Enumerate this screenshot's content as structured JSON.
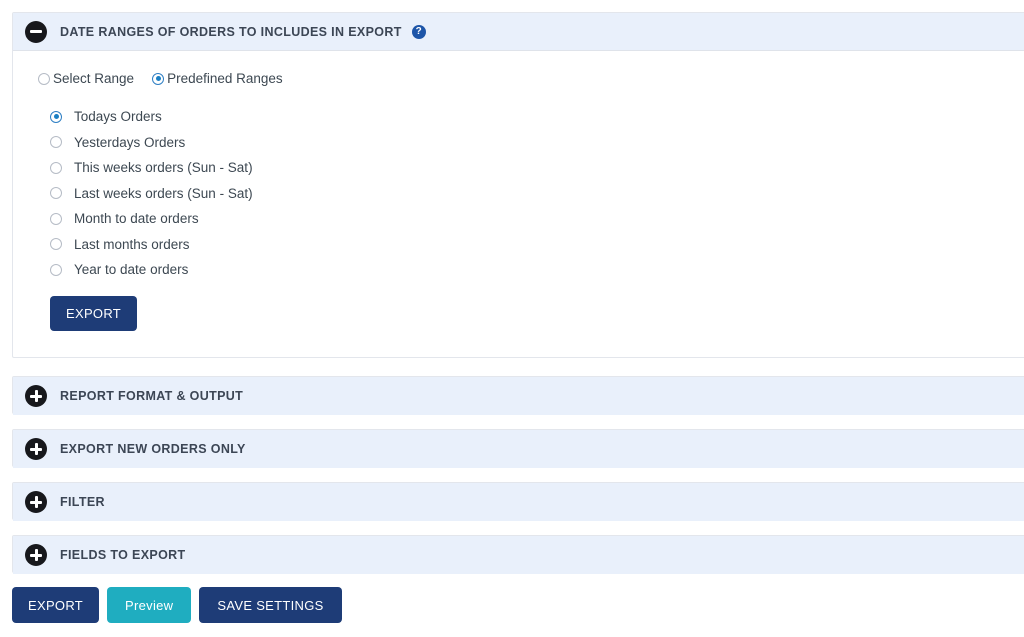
{
  "theme": {
    "header_band": "#e9f0fb",
    "navy": "#1e3c77",
    "teal": "#1fadc0",
    "radio_accent": "#1b7fc4",
    "help_icon": "#1d55a8",
    "text": "#3d4852"
  },
  "sections": [
    {
      "id": "date-ranges",
      "title": "DATE RANGES OF ORDERS TO INCLUDES IN EXPORT",
      "toggle_icon": "minus-circle-icon",
      "expanded": true,
      "help_icon": "help-icon",
      "help_glyph": "?"
    },
    {
      "id": "report-format-output",
      "title": "REPORT FORMAT & OUTPUT",
      "toggle_icon": "plus-circle-icon",
      "expanded": false
    },
    {
      "id": "export-new-orders-only",
      "title": "EXPORT NEW ORDERS ONLY",
      "toggle_icon": "plus-circle-icon",
      "expanded": false
    },
    {
      "id": "filter",
      "title": "FILTER",
      "toggle_icon": "plus-circle-icon",
      "expanded": false
    },
    {
      "id": "fields-to-export",
      "title": "FIELDS TO EXPORT",
      "toggle_icon": "plus-circle-icon",
      "expanded": false
    }
  ],
  "date_ranges": {
    "mode_options": [
      {
        "label": "Select Range",
        "selected": false
      },
      {
        "label": "Predefined Ranges",
        "selected": true
      }
    ],
    "predefined_ranges": [
      {
        "label": "Todays Orders",
        "selected": true
      },
      {
        "label": "Yesterdays Orders",
        "selected": false
      },
      {
        "label": "This weeks orders (Sun - Sat)",
        "selected": false
      },
      {
        "label": "Last weeks orders (Sun - Sat)",
        "selected": false
      },
      {
        "label": "Month to date orders",
        "selected": false
      },
      {
        "label": "Last months orders",
        "selected": false
      },
      {
        "label": "Year to date orders",
        "selected": false
      }
    ],
    "export_button_label": "EXPORT"
  },
  "footer": {
    "export_label": "EXPORT",
    "preview_label": "Preview",
    "save_settings_label": "SAVE SETTINGS"
  }
}
